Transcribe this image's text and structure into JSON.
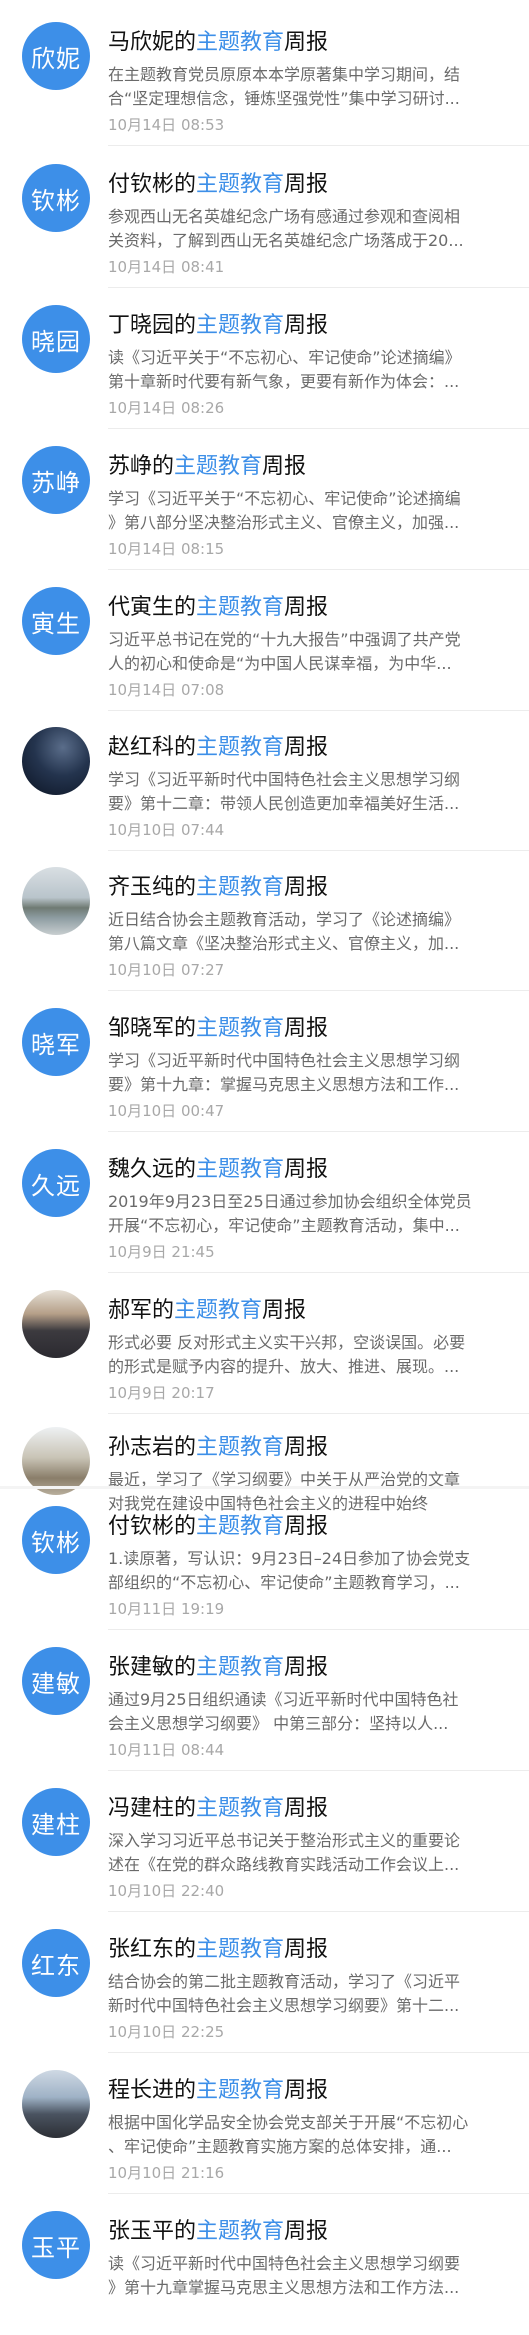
{
  "title_suffix": "周报",
  "title_highlight": "主题教育",
  "items": [
    {
      "name": "马欣妮",
      "avatar": "欣妮",
      "avatar_type": "text",
      "prefix": "马欣妮的",
      "line1": "在主题教育党员原原本本学原著集中学习期间，结",
      "line2": "合“坚定理想信念，锤炼坚强党性”集中学习研讨...",
      "time": "10月14日 08:53"
    },
    {
      "name": "付钦彬",
      "avatar": "钦彬",
      "avatar_type": "text",
      "prefix": "付钦彬的",
      "line1": "参观西山无名英雄纪念广场有感通过参观和查阅相",
      "line2": "关资料，了解到西山无名英雄纪念广场落成于20...",
      "time": "10月14日 08:41"
    },
    {
      "name": "丁晓园",
      "avatar": "晓园",
      "avatar_type": "text",
      "prefix": "丁晓园的",
      "line1": "读《习近平关于“不忘初心、牢记使命”论述摘编》",
      "line2": "第十章新时代要有新气象，更要有新作为体会：...",
      "time": "10月14日 08:26"
    },
    {
      "name": "苏峥",
      "avatar": "苏峥",
      "avatar_type": "text",
      "prefix": "苏峥的",
      "line1": "学习《习近平关于“不忘初心、牢记使命”论述摘编",
      "line2": "》第八部分坚决整治形式主义、官僚主义，加强...",
      "time": "10月14日 08:15"
    },
    {
      "name": "代寅生",
      "avatar": "寅生",
      "avatar_type": "text",
      "prefix": "代寅生的",
      "line1": "习近平总书记在党的“十九大报告”中强调了共产党",
      "line2": "人的初心和使命是“为中国人民谋幸福，为中华...",
      "time": "10月14日 07:08"
    },
    {
      "name": "赵红科",
      "avatar": "",
      "avatar_type": "photo-night",
      "prefix": "赵红科的",
      "line1": "学习《习近平新时代中国特色社会主义思想学习纲",
      "line2": "要》第十二章：带领人民创造更加幸福美好生活...",
      "time": "10月10日 07:44"
    },
    {
      "name": "齐玉纯",
      "avatar": "",
      "avatar_type": "photo-lake",
      "prefix": "齐玉纯的",
      "line1": "近日结合协会主题教育活动，学习了《论述摘编》",
      "line2": "第八篇文章《坚决整治形式主义、官僚主义，加...",
      "time": "10月10日 07:27"
    },
    {
      "name": "邹晓军",
      "avatar": "晓军",
      "avatar_type": "text",
      "prefix": "邹晓军的",
      "line1": "学习《习近平新时代中国特色社会主义思想学习纲",
      "line2": "要》第十九章：掌握马克思主义思想方法和工作...",
      "time": "10月10日 00:47"
    },
    {
      "name": "魏久远",
      "avatar": "久远",
      "avatar_type": "text",
      "prefix": "魏久远的",
      "line1": "2019年9月23日至25日通过参加协会组织全体党员",
      "line2": "开展“不忘初心，牢记使命”主题教育活动，集中...",
      "time": "10月9日 21:45"
    },
    {
      "name": "郝军",
      "avatar": "",
      "avatar_type": "photo-man",
      "prefix": "郝军的",
      "line1": "形式必要 反对形式主义实干兴邦，空谈误国。必要",
      "line2": "的形式是赋予内容的提升、放大、推进、展现。...",
      "time": "10月9日 20:17"
    },
    {
      "name": "孙志岩",
      "avatar": "",
      "avatar_type": "photo-statue",
      "prefix": "孙志岩的",
      "line1": "最近，学习了《学习纲要》中关于从严治党的文章",
      "line2": "对我党在建设中国特色社会主义的进程中始终",
      "time": ""
    },
    {
      "name": "付钦彬",
      "avatar": "钦彬",
      "avatar_type": "text",
      "prefix": "付钦彬的",
      "line1": "1.读原著，写认识：9月23日–24日参加了协会党支",
      "line2": "部组织的“不忘初心、牢记使命”主题教育学习，...",
      "time": "10月11日 19:19"
    },
    {
      "name": "张建敏",
      "avatar": "建敏",
      "avatar_type": "text",
      "prefix": "张建敏的",
      "line1": "通过9月25日组织通读《习近平新时代中国特色社",
      "line2": "会主义思想学习纲要》 中第三部分：坚持以人...",
      "time": "10月11日 08:44"
    },
    {
      "name": "冯建柱",
      "avatar": "建柱",
      "avatar_type": "text",
      "prefix": "冯建柱的",
      "line1": "深入学习习近平总书记关于整治形式主义的重要论",
      "line2": "述在《在党的群众路线教育实践活动工作会议上...",
      "time": "10月10日 22:40"
    },
    {
      "name": "张红东",
      "avatar": "红东",
      "avatar_type": "text",
      "prefix": "张红东的",
      "line1": "结合协会的第二批主题教育活动，学习了《习近平",
      "line2": "新时代中国特色社会主义思想学习纲要》第十二...",
      "time": "10月10日 22:25"
    },
    {
      "name": "程长进",
      "avatar": "",
      "avatar_type": "photo-mountain",
      "prefix": "程长进的",
      "line1": "根据中国化学品安全协会党支部关于开展“不忘初心",
      "line2": "、牢记使命”主题教育实施方案的总体安排，通...",
      "time": "10月10日 21:16"
    },
    {
      "name": "张玉平",
      "avatar": "玉平",
      "avatar_type": "text",
      "prefix": "张玉平的",
      "line1": "读《习近平新时代中国特色社会主义思想学习纲要",
      "line2": "》第十九章掌握马克思主义思想方法和工作方法...",
      "time": ""
    }
  ]
}
